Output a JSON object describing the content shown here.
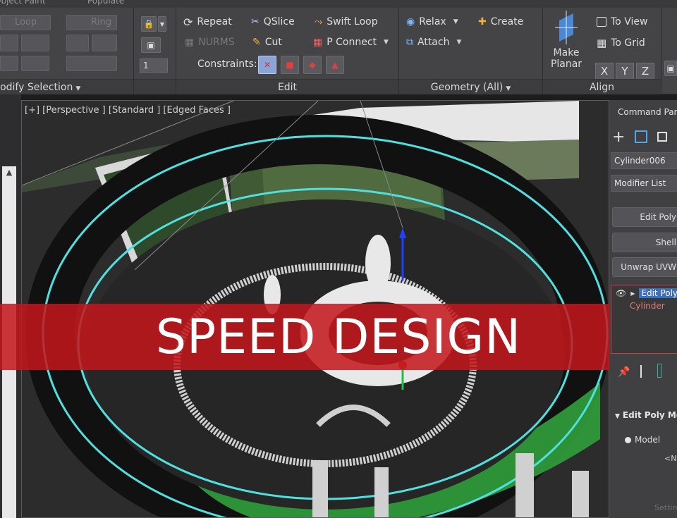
{
  "ribbon": {
    "top_tabs": [
      "Object Paint",
      "Populate"
    ],
    "modify_selection": {
      "title": "Modify Selection",
      "ghost_items": [
        "Loop",
        "Ring"
      ],
      "spinner_value": "1"
    },
    "edit": {
      "title": "Edit",
      "buttons": [
        {
          "label": "Repeat",
          "icon": "repeat-icon"
        },
        {
          "label": "QSlice",
          "icon": "qslice-icon"
        },
        {
          "label": "Swift Loop",
          "icon": "swift-loop-icon"
        },
        {
          "label": "NURMS",
          "icon": "nurms-icon",
          "disabled": true
        },
        {
          "label": "Cut",
          "icon": "cut-icon"
        },
        {
          "label": "P Connect",
          "icon": "p-connect-icon"
        }
      ],
      "constraints_label": "Constraints:"
    },
    "geometry": {
      "title": "Geometry (All)",
      "buttons": [
        {
          "label": "Relax",
          "icon": "relax-icon"
        },
        {
          "label": "Create",
          "icon": "create-icon"
        },
        {
          "label": "Attach",
          "icon": "attach-icon"
        }
      ]
    },
    "align": {
      "title": "Align",
      "make_planar": [
        "Make",
        "Planar"
      ],
      "to_view": "To View",
      "to_grid": "To Grid",
      "axes": [
        "X",
        "Y",
        "Z"
      ]
    }
  },
  "viewport": {
    "label": "[+] [Perspective ] [Standard ] [Edged Faces ]",
    "colors": {
      "wire": "#4fe0e0",
      "wall_green": "#2f9a3a",
      "floor": "#262626"
    }
  },
  "banner": {
    "text": "SPEED DESIGN",
    "color": "#c4161c"
  },
  "command_panel": {
    "title": "Command Panel",
    "object_name": "Cylinder006",
    "modifier_list": "Modifier List",
    "modifier_buttons": [
      "Edit Poly",
      "Shell",
      "Unwrap UVW"
    ],
    "stack": {
      "selected": "Edit Poly",
      "base": "Cylinder"
    },
    "rollout": "Edit Poly Mode",
    "model_label": "Model",
    "none_text": "<None>",
    "settings_text": "Settings"
  }
}
